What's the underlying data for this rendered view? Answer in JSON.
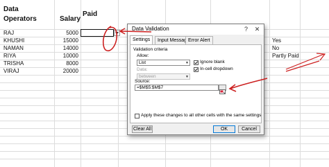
{
  "sheet": {
    "headers": {
      "col_a": "Data\nOperators",
      "col_b": "Salary",
      "col_c": "Paid"
    },
    "header_lines": [
      "Data",
      "Operators"
    ],
    "rows": [
      {
        "name": "RAJ",
        "salary": "5000"
      },
      {
        "name": "KHUSHI",
        "salary": "15000"
      },
      {
        "name": "NAMAN",
        "salary": "14000"
      },
      {
        "name": "RIYA",
        "salary": "10000"
      },
      {
        "name": "TRISHA",
        "salary": "8000"
      },
      {
        "name": "VIRAJ",
        "salary": "20000"
      }
    ],
    "options_list": [
      "Yes",
      "No",
      "Partly Paid"
    ]
  },
  "dialog": {
    "title": "Data Validation",
    "help": "?",
    "close": "✕",
    "tabs": [
      "Settings",
      "Input Message",
      "Error Alert"
    ],
    "criteria_label": "Validation criteria",
    "allow_label": "Allow:",
    "allow_value": "List",
    "data_label": "Data:",
    "data_value": "between",
    "ignore_blank": "Ignore blank",
    "in_cell_dropdown": "In-cell dropdown",
    "source_label": "Source:",
    "source_value": "=$M$5:$M$7",
    "apply_label": "Apply these changes to all other cells with the same settings",
    "clear_all": "Clear All",
    "ok": "OK",
    "cancel": "Cancel"
  },
  "colors": {
    "annotation": "#cc1f1f",
    "ok_border": "#0078d7"
  },
  "icons": [
    "dropdown-arrow-icon",
    "range-collapse-icon",
    "check-icon"
  ]
}
